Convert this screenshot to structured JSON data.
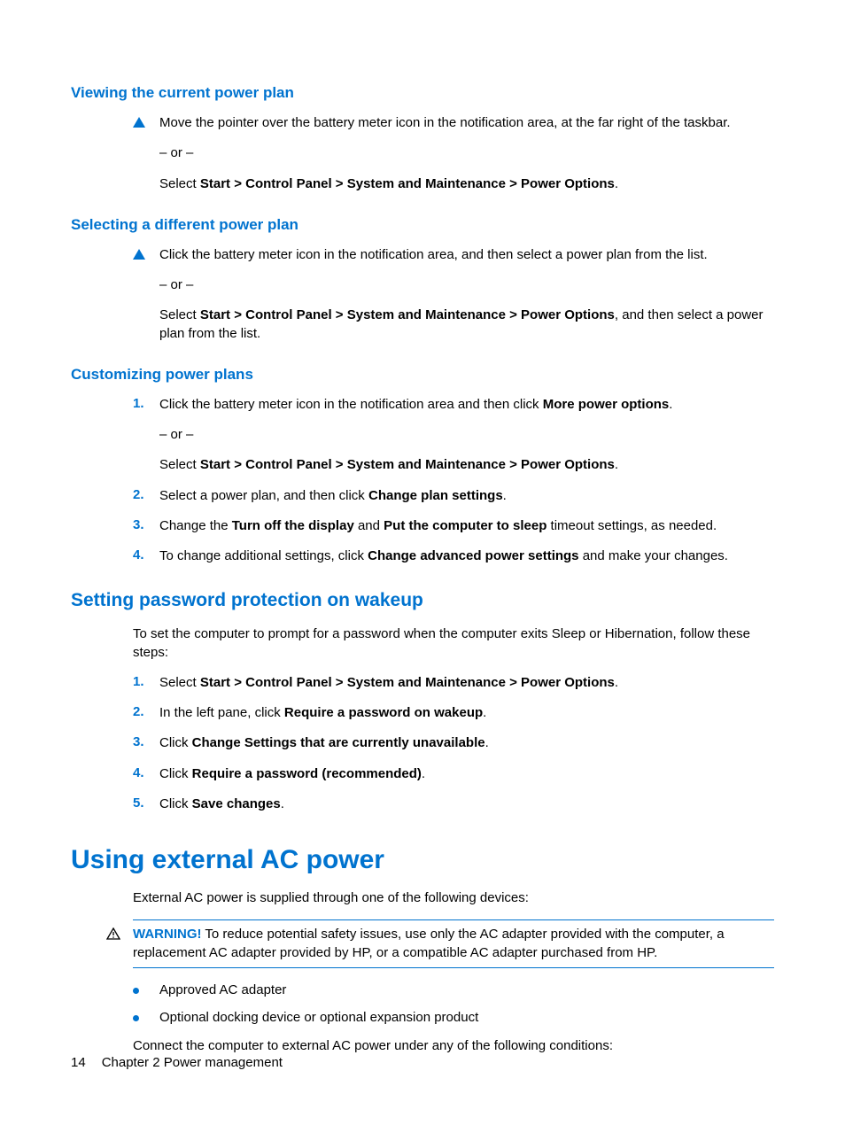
{
  "sec1": {
    "title": "Viewing the current power plan",
    "item": {
      "p1": "Move the pointer over the battery meter icon in the notification area, at the far right of the taskbar.",
      "or": "– or –",
      "p2_a": "Select ",
      "p2_b": "Start > Control Panel > System and Maintenance > Power Options",
      "p2_c": "."
    }
  },
  "sec2": {
    "title": "Selecting a different power plan",
    "item": {
      "p1": "Click the battery meter icon in the notification area, and then select a power plan from the list.",
      "or": "– or –",
      "p2_a": "Select ",
      "p2_b": "Start > Control Panel > System and Maintenance > Power Options",
      "p2_c": ", and then select a power plan from the list."
    }
  },
  "sec3": {
    "title": "Customizing power plans",
    "steps": [
      {
        "num": "1.",
        "p1_a": "Click the battery meter icon in the notification area and then click ",
        "p1_b": "More power options",
        "p1_c": ".",
        "or": "– or –",
        "p2_a": "Select ",
        "p2_b": "Start > Control Panel > System and Maintenance > Power Options",
        "p2_c": "."
      },
      {
        "num": "2.",
        "p1_a": "Select a power plan, and then click ",
        "p1_b": "Change plan settings",
        "p1_c": "."
      },
      {
        "num": "3.",
        "p1_a": "Change the ",
        "p1_b": "Turn off the display",
        "p1_c": " and ",
        "p1_d": "Put the computer to sleep",
        "p1_e": " timeout settings, as needed."
      },
      {
        "num": "4.",
        "p1_a": "To change additional settings, click ",
        "p1_b": "Change advanced power settings",
        "p1_c": " and make your changes."
      }
    ]
  },
  "sec4": {
    "title": "Setting password protection on wakeup",
    "intro": "To set the computer to prompt for a password when the computer exits Sleep or Hibernation, follow these steps:",
    "steps": [
      {
        "num": "1.",
        "p1_a": "Select ",
        "p1_b": "Start > Control Panel > System and Maintenance > Power Options",
        "p1_c": "."
      },
      {
        "num": "2.",
        "p1_a": "In the left pane, click ",
        "p1_b": "Require a password on wakeup",
        "p1_c": "."
      },
      {
        "num": "3.",
        "p1_a": "Click ",
        "p1_b": "Change Settings that are currently unavailable",
        "p1_c": "."
      },
      {
        "num": "4.",
        "p1_a": "Click ",
        "p1_b": "Require a password (recommended)",
        "p1_c": "."
      },
      {
        "num": "5.",
        "p1_a": "Click ",
        "p1_b": "Save changes",
        "p1_c": "."
      }
    ]
  },
  "sec5": {
    "title": "Using external AC power",
    "p1": "External AC power is supplied through one of the following devices:",
    "warning": {
      "label": "WARNING!",
      "text": "   To reduce potential safety issues, use only the AC adapter provided with the computer, a replacement AC adapter provided by HP, or a compatible AC adapter purchased from HP."
    },
    "bullets": [
      "Approved AC adapter",
      "Optional docking device or optional expansion product"
    ],
    "p2": "Connect the computer to external AC power under any of the following conditions:"
  },
  "footer": {
    "page": "14",
    "chapter": "Chapter 2   Power management"
  }
}
